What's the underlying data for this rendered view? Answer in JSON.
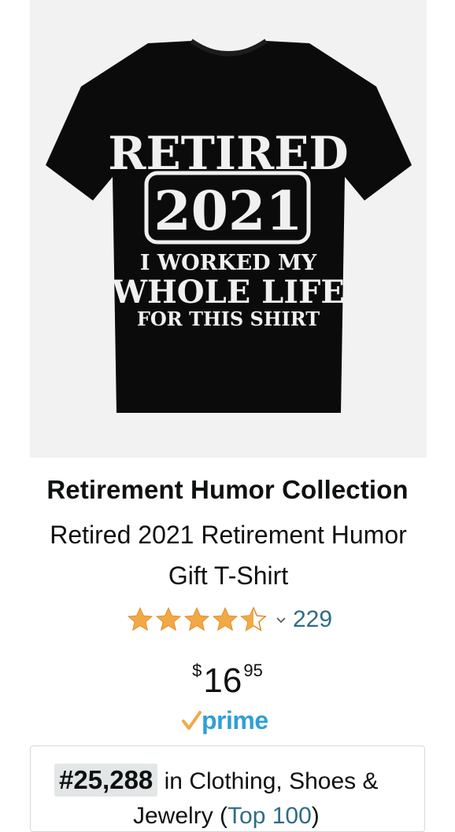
{
  "product": {
    "image_alt": "Retired 2021 T-Shirt",
    "shirt_print": {
      "line1": "RETIRED",
      "line2": "2021",
      "line3": "I WORKED MY",
      "line4": "WHOLE LIFE",
      "line5": "FOR THIS SHIRT"
    },
    "brand": "Retirement Humor Collection",
    "title": "Retired 2021 Retirement Humor Gift T-Shirt",
    "rating": {
      "value": 4.5,
      "max": 5,
      "review_count": "229"
    },
    "price": {
      "symbol": "$",
      "whole": "16",
      "fraction": "95"
    },
    "prime_label": "prime",
    "best_seller": {
      "rank": "#25,288",
      "category_text": "in Clothing, Shoes &",
      "category_text2": "Jewelry (",
      "top100_link": "Top 100",
      "close_paren": ")"
    }
  },
  "colors": {
    "star": "#f3a847",
    "link": "#2f6c86",
    "prime_blue": "#2f9fd8",
    "prime_check": "#f3a847"
  },
  "icons": [
    "star-full-icon",
    "star-half-icon",
    "chevron-down-icon",
    "prime-check-icon"
  ]
}
